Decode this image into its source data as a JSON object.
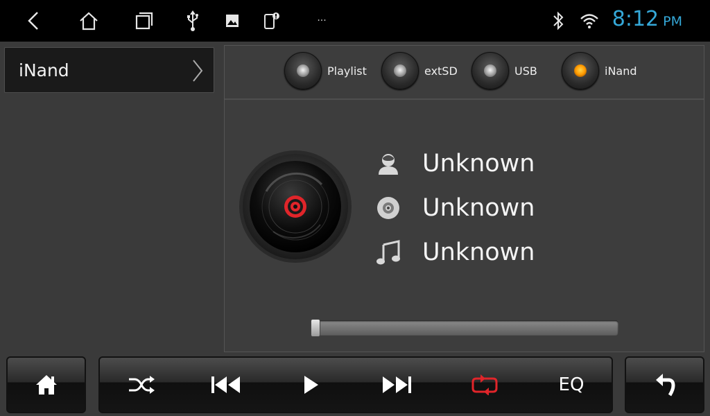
{
  "statusbar": {
    "icons": [
      "back-icon",
      "home-icon",
      "recents-icon",
      "usb-icon",
      "image-icon",
      "phone-notification-icon",
      "more-dots-icon",
      "bluetooth-icon",
      "wifi-icon"
    ],
    "more_label": "···",
    "time": "8:12",
    "ampm": "PM",
    "time_color": "#35a8d8"
  },
  "source_selector": {
    "label": "iNand"
  },
  "tabs": [
    {
      "label": "Playlist",
      "active": false
    },
    {
      "label": "extSD",
      "active": false
    },
    {
      "label": "USB",
      "active": false
    },
    {
      "label": "iNand",
      "active": true
    }
  ],
  "track": {
    "artist": "Unknown",
    "album": "Unknown",
    "title": "Unknown"
  },
  "progress": {
    "fraction": 0.0
  },
  "controls": {
    "home_icon": "home-icon",
    "shuffle_icon": "shuffle-icon",
    "prev_icon": "previous-track-icon",
    "play_icon": "play-icon",
    "next_icon": "next-track-icon",
    "repeat_icon": "repeat-icon",
    "repeat_color": "#e0252a",
    "eq_label": "EQ",
    "back_icon": "back-arrow-icon"
  },
  "colors": {
    "accent": "#35a8d8",
    "active_led": "#ff9a00",
    "disc_center": "#e0252a"
  }
}
